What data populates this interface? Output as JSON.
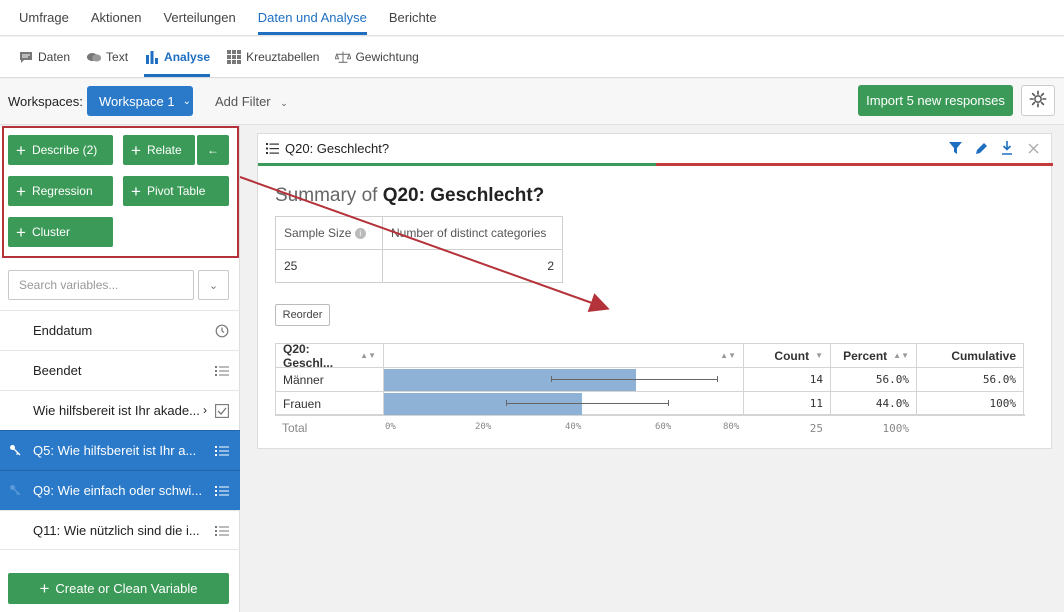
{
  "topnav": {
    "tabs": [
      {
        "label": "Umfrage"
      },
      {
        "label": "Aktionen"
      },
      {
        "label": "Verteilungen"
      },
      {
        "label": "Daten und Analyse"
      },
      {
        "label": "Berichte"
      }
    ],
    "active": "Daten und Analyse"
  },
  "subnav": {
    "tabs": [
      {
        "label": "Daten",
        "icon": "chat-icon"
      },
      {
        "label": "Text",
        "icon": "speech-bubbles-icon"
      },
      {
        "label": "Analyse",
        "icon": "bar-chart-icon"
      },
      {
        "label": "Kreuztabellen",
        "icon": "grid-icon"
      },
      {
        "label": "Gewichtung",
        "icon": "scale-icon"
      }
    ],
    "active": "Analyse"
  },
  "workspace": {
    "label": "Workspaces:",
    "current": "Workspace 1",
    "add_filter": "Add Filter",
    "import_label": "Import 5 new responses"
  },
  "left": {
    "buttons": {
      "describe": "Describe (2)",
      "relate": "Relate",
      "back": "←",
      "regression": "Regression",
      "pivot": "Pivot Table",
      "cluster": "Cluster"
    },
    "search_placeholder": "Search variables...",
    "variables": [
      {
        "label": "Enddatum",
        "icon": "clock-icon",
        "selected": false
      },
      {
        "label": "Beendet",
        "icon": "list-icon",
        "selected": false
      },
      {
        "label": "Wie hilfsbereit ist Ihr akade...",
        "icon": "checkbox-icon",
        "selected": false
      },
      {
        "label": "Q5: Wie hilfsbereit ist Ihr a...",
        "icon": "list-icon",
        "selected": true
      },
      {
        "label": "Q9: Wie einfach oder schwi...",
        "icon": "list-icon",
        "selected": true
      },
      {
        "label": "Q11: Wie nützlich sind die i...",
        "icon": "list-icon",
        "selected": false
      }
    ],
    "create_label": "Create or Clean Variable"
  },
  "card": {
    "title": "Q20: Geschlecht?",
    "summary_prefix": "Summary of",
    "summary_question": "Q20: Geschlecht?",
    "sample_size_label": "Sample Size",
    "distinct_label": "Number of distinct categories",
    "sample_size": "25",
    "distinct": "2",
    "reorder_label": "Reorder",
    "table_headers": {
      "variable": "Q20: Geschl...",
      "count": "Count",
      "percent": "Percent",
      "cumulative": "Cumulative"
    },
    "total_label": "Total",
    "total_count": "25",
    "total_percent": "100%"
  },
  "chart_data": {
    "type": "bar",
    "categories": [
      "Männer",
      "Frauen"
    ],
    "counts": [
      14,
      11
    ],
    "count_labels": [
      "14",
      "11"
    ],
    "percents": [
      56.0,
      44.0
    ],
    "percent_labels": [
      "56.0%",
      "44.0%"
    ],
    "cumulative_labels": [
      "56.0%",
      "100%"
    ],
    "error_low": [
      37,
      27
    ],
    "error_high": [
      74,
      63
    ],
    "xlim": [
      0,
      80
    ],
    "ticks": [
      "0%",
      "20%",
      "40%",
      "60%",
      "80%"
    ],
    "colors": {
      "bar": "#8eb2d6"
    }
  }
}
